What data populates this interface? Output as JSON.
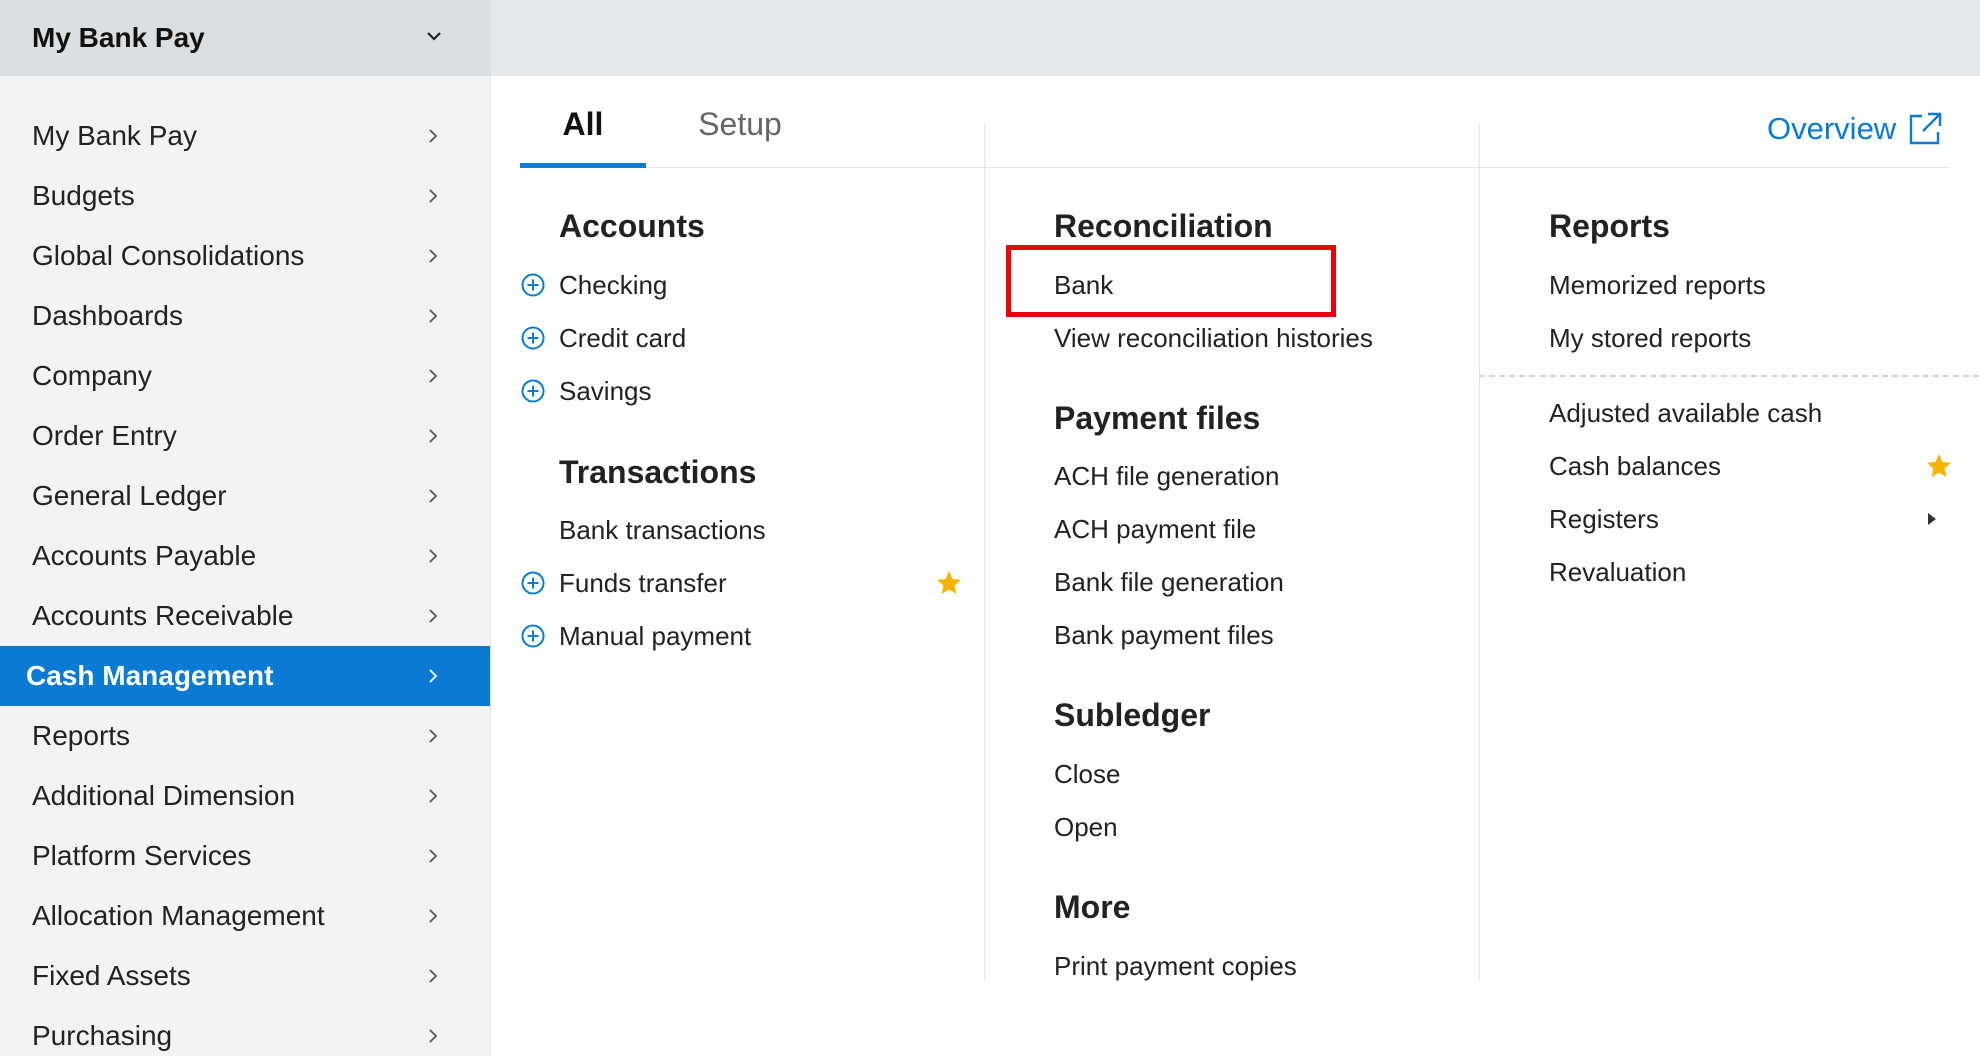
{
  "app": {
    "title": "My Bank Pay"
  },
  "sidebar": {
    "items": [
      {
        "label": "My Bank Pay"
      },
      {
        "label": "Budgets"
      },
      {
        "label": "Global Consolidations"
      },
      {
        "label": "Dashboards"
      },
      {
        "label": "Company"
      },
      {
        "label": "Order Entry"
      },
      {
        "label": "General Ledger"
      },
      {
        "label": "Accounts Payable"
      },
      {
        "label": "Accounts Receivable"
      },
      {
        "label": "Cash Management",
        "active": true
      },
      {
        "label": "Reports"
      },
      {
        "label": "Additional Dimension"
      },
      {
        "label": "Platform Services"
      },
      {
        "label": "Allocation Management"
      },
      {
        "label": "Fixed Assets"
      },
      {
        "label": "Purchasing"
      }
    ]
  },
  "tabs": {
    "all": "All",
    "setup": "Setup",
    "active": "All"
  },
  "overview": {
    "label": "Overview",
    "icon": "external-link-icon"
  },
  "columns": {
    "accounts": {
      "title": "Accounts",
      "items": [
        "Checking",
        "Credit card",
        "Savings"
      ]
    },
    "transactions": {
      "title": "Transactions",
      "items": [
        "Bank transactions",
        "Funds transfer",
        "Manual payment"
      ]
    },
    "reconciliation": {
      "title": "Reconciliation",
      "items": [
        "Bank",
        "View reconciliation histories"
      ]
    },
    "payment_files": {
      "title": "Payment files",
      "items": [
        "ACH file generation",
        "ACH payment file",
        "Bank file generation",
        "Bank payment files"
      ]
    },
    "subledger": {
      "title": "Subledger",
      "items": [
        "Close",
        "Open"
      ]
    },
    "more": {
      "title": "More",
      "items": [
        "Print payment copies"
      ]
    },
    "reports": {
      "title": "Reports",
      "items": [
        "Memorized reports",
        "My stored reports",
        "Adjusted available cash",
        "Cash balances",
        "Registers",
        "Revaluation"
      ]
    }
  },
  "colors": {
    "accent": "#0a7ad2",
    "highlight": "#e8000b",
    "star": "#f5b400"
  }
}
